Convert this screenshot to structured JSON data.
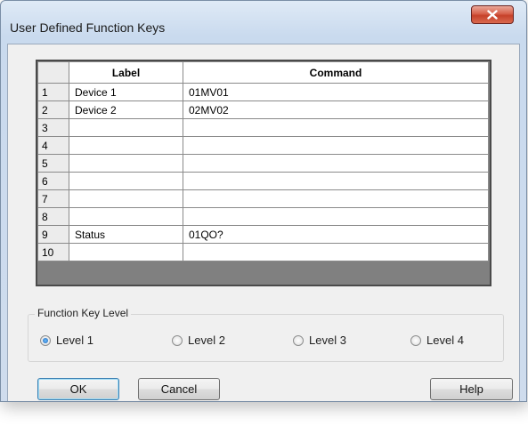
{
  "window": {
    "title": "User Defined Function Keys",
    "close_glyph": "X"
  },
  "grid": {
    "headers": {
      "label": "Label",
      "command": "Command"
    },
    "rows": [
      {
        "num": "1",
        "label": "Device 1",
        "command": "01MV01"
      },
      {
        "num": "2",
        "label": "Device 2",
        "command": "02MV02"
      },
      {
        "num": "3",
        "label": "",
        "command": ""
      },
      {
        "num": "4",
        "label": "",
        "command": ""
      },
      {
        "num": "5",
        "label": "",
        "command": ""
      },
      {
        "num": "6",
        "label": "",
        "command": ""
      },
      {
        "num": "7",
        "label": "",
        "command": ""
      },
      {
        "num": "8",
        "label": "",
        "command": ""
      },
      {
        "num": "9",
        "label": "Status",
        "command": "01QO?"
      },
      {
        "num": "10",
        "label": "",
        "command": ""
      }
    ]
  },
  "function_key_level": {
    "title": "Function Key Level",
    "options": [
      {
        "label": "Level 1",
        "checked": true
      },
      {
        "label": "Level 2",
        "checked": false
      },
      {
        "label": "Level 3",
        "checked": false
      },
      {
        "label": "Level 4",
        "checked": false
      }
    ]
  },
  "buttons": {
    "ok": "OK",
    "cancel": "Cancel",
    "help": "Help"
  },
  "colors": {
    "title_bar": "#c9daee",
    "close_button": "#c6412a",
    "client_background": "#f0f0f0",
    "radio_selected": "#1a5fb5"
  }
}
